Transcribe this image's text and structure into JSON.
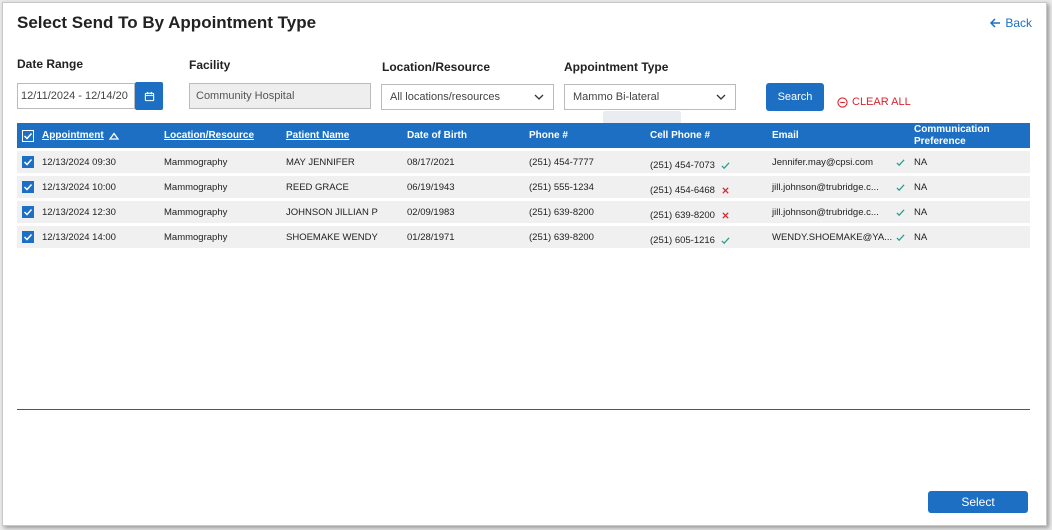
{
  "window": {
    "title": "Select Send To By Appointment Type",
    "back_label": "Back"
  },
  "filters": {
    "date_range_label": "Date Range",
    "date_range_value": "12/11/2024 - 12/14/20",
    "facility_label": "Facility",
    "facility_value": "Community Hospital",
    "location_label": "Location/Resource",
    "location_value": "All locations/resources",
    "appointment_type_label": "Appointment Type",
    "appointment_type_value": "Mammo Bi-lateral",
    "search_label": "Search",
    "clear_label": "CLEAR ALL"
  },
  "table": {
    "headers": {
      "appointment": "Appointment",
      "location": "Location/Resource",
      "patient": "Patient Name",
      "dob": "Date of Birth",
      "phone": "Phone #",
      "cell": "Cell Phone #",
      "email": "Email",
      "comm_line1": "Communication",
      "comm_line2": "Preference"
    },
    "rows": [
      {
        "appointment": "12/13/2024 09:30",
        "location": "Mammography",
        "patient": "MAY JENNIFER",
        "dob": "08/17/2021",
        "phone": "(251) 454-7777",
        "cell": "(251) 454-7073",
        "cell_valid": true,
        "email": "Jennifer.may@cpsi.com",
        "pref": "NA"
      },
      {
        "appointment": "12/13/2024 10:00",
        "location": "Mammography",
        "patient": "REED GRACE",
        "dob": "06/19/1943",
        "phone": "(251) 555-1234",
        "cell": "(251) 454-6468",
        "cell_valid": false,
        "email": "jill.johnson@trubridge.c...",
        "pref": "NA"
      },
      {
        "appointment": "12/13/2024 12:30",
        "location": "Mammography",
        "patient": "JOHNSON JILLIAN P",
        "dob": "02/09/1983",
        "phone": "(251) 639-8200",
        "cell": "(251) 639-8200",
        "cell_valid": false,
        "email": "jill.johnson@trubridge.c...",
        "pref": "NA"
      },
      {
        "appointment": "12/13/2024 14:00",
        "location": "Mammography",
        "patient": "SHOEMAKE WENDY",
        "dob": "01/28/1971",
        "phone": "(251) 639-8200",
        "cell": "(251) 605-1216",
        "cell_valid": true,
        "email": "WENDY.SHOEMAKE@YA...",
        "pref": "NA"
      }
    ]
  },
  "footer": {
    "select_label": "Select"
  },
  "colors": {
    "primary": "#1d6fc4",
    "valid": "#2a9d8f",
    "invalid": "#d9232d"
  }
}
